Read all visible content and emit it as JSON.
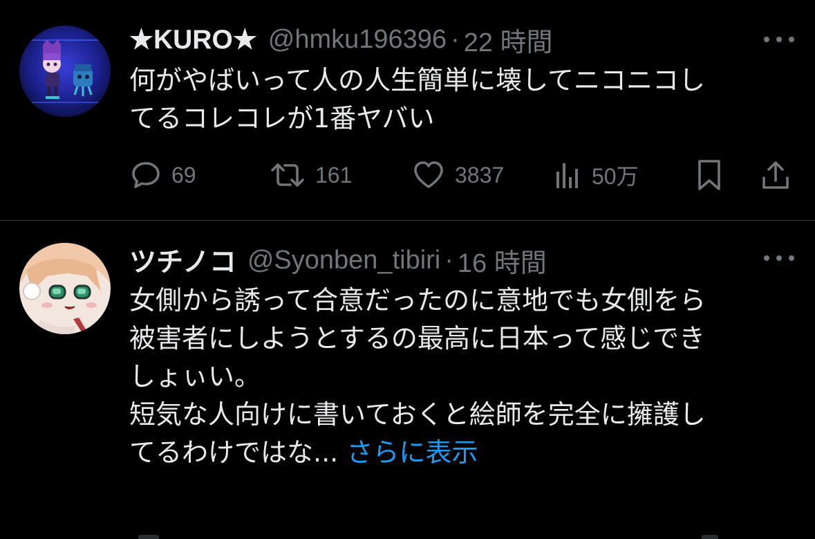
{
  "colors": {
    "background": "#000000",
    "primary_text": "#e7e9ea",
    "secondary_text": "#71767b",
    "link": "#1d9bf0",
    "divider": "#2f3336"
  },
  "tweets": [
    {
      "display_name": "★KURO★",
      "handle": "@hmku196396",
      "separator": "·",
      "time": "22 時間",
      "text": "何がやばいって人の人生簡単に壊してニコニコし\nてるコレコレが1番ヤバい",
      "avatar_icon": "avatar-kuro",
      "actions": {
        "reply_count": "69",
        "retweet_count": "161",
        "like_count": "3837",
        "view_count": "50万"
      }
    },
    {
      "display_name": "ツチノコ",
      "handle": "@Syonben_tibiri",
      "separator": "·",
      "time": "16 時間",
      "text": "女側から誘って合意だったのに意地でも女側をら\n被害者にしようとするの最高に日本って感じでき\nしょぃい。\n短気な人向けに書いておくと絵師を完全に擁護し\nてるわけではな... ",
      "show_more": "さらに表示",
      "avatar_icon": "avatar-tsuchinoko"
    }
  ]
}
